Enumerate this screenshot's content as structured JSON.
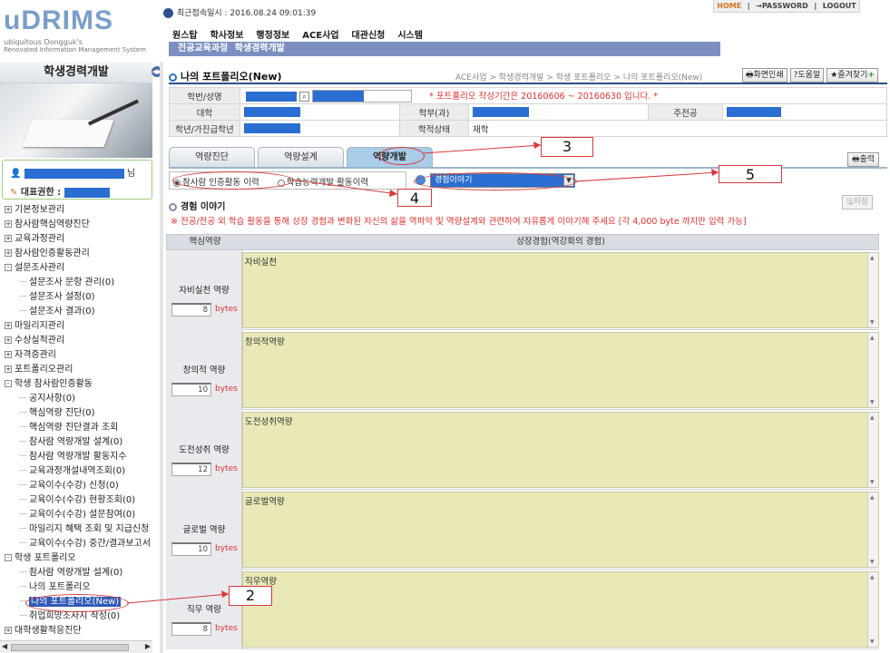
{
  "logo": {
    "title": "uDRIMS",
    "line1": "ubiquitous Dongguk's",
    "line2": "Renovated Information Management System"
  },
  "last_login": "최근접속일시 : 2016.08.24 09:01:39",
  "top_links": {
    "home": "HOME",
    "password": "PASSWORD",
    "logout": "LOGOUT",
    "sep": "|"
  },
  "main_menu": [
    "원스탑",
    "학사정보",
    "행정정보",
    "ACE사업",
    "대관신청",
    "시스템"
  ],
  "sub_menu": [
    "전공교육과정",
    "학생경력개발"
  ],
  "left": {
    "heading": "학생경력개발",
    "user_suffix": "님",
    "role_label": "대표권한 :"
  },
  "tree": [
    {
      "label": "기본정보관리",
      "level": 0,
      "sign": "+"
    },
    {
      "label": "참사람핵심역량진단",
      "level": 0,
      "sign": "+"
    },
    {
      "label": "교육과정관리",
      "level": 0,
      "sign": "+"
    },
    {
      "label": "참사람인증활동관리",
      "level": 0,
      "sign": "+"
    },
    {
      "label": "설문조사관리",
      "level": 0,
      "sign": "-"
    },
    {
      "label": "설문조사 문항 관리(0)",
      "level": 1
    },
    {
      "label": "설문조사 설정(0)",
      "level": 1
    },
    {
      "label": "설문조사 결과(0)",
      "level": 1
    },
    {
      "label": "마일리지관리",
      "level": 0,
      "sign": "+"
    },
    {
      "label": "수상실적관리",
      "level": 0,
      "sign": "+"
    },
    {
      "label": "자격증관리",
      "level": 0,
      "sign": "+"
    },
    {
      "label": "포트폴리오관리",
      "level": 0,
      "sign": "+"
    },
    {
      "label": "학생 참사람인증활동",
      "level": 0,
      "sign": "-"
    },
    {
      "label": "공지사항(0)",
      "level": 1
    },
    {
      "label": "핵심역량 진단(0)",
      "level": 1
    },
    {
      "label": "핵심역량 진단결과 조회",
      "level": 1
    },
    {
      "label": "참사람 역량개발 설계(0)",
      "level": 1
    },
    {
      "label": "참사람 역량개발 활동지수",
      "level": 1
    },
    {
      "label": "교육과정개설내역조회(0)",
      "level": 1
    },
    {
      "label": "교육이수(수강) 신청(0)",
      "level": 1
    },
    {
      "label": "교육이수(수강) 현황조회(0)",
      "level": 1
    },
    {
      "label": "교육이수(수강) 설문참여(0)",
      "level": 1
    },
    {
      "label": "마일리지 혜택 조회 및 지급신청",
      "level": 1
    },
    {
      "label": "교육이수(수강) 중간/결과보고서",
      "level": 1
    },
    {
      "label": "학생 포트폴리오",
      "level": 0,
      "sign": "-"
    },
    {
      "label": "참사람 역량개발 설계(0)",
      "level": 1
    },
    {
      "label": "나의 포트폴리오",
      "level": 1
    },
    {
      "label": "나의 포트폴리오(New)",
      "level": 1,
      "selected": true
    },
    {
      "label": "취업희망조사지 작성(0)",
      "level": 1
    },
    {
      "label": "대학생활적응진단",
      "level": 0,
      "sign": "+"
    }
  ],
  "content": {
    "title": "나의 포트폴리오(New)",
    "breadcrumb": "ACE사업 > 학생경력개발 > 학생 포트폴리오 > 나의 포트폴리오(New)",
    "buttons": {
      "print_screen": "화면인쇄",
      "help": "도움말",
      "favorite": "즐겨찾기"
    },
    "info": {
      "student_label": "학번/성명",
      "notice": "* 포트폴리오  작성기간은 20160606 ~ 20160630 입니다. *",
      "college_label": "대학",
      "dept_label": "학부(과)",
      "major_label": "주전공",
      "grade_label": "학년/가진급학년",
      "status_label": "학적상태",
      "status_value": "재학"
    },
    "tabs": [
      {
        "label": "역량진단",
        "active": false
      },
      {
        "label": "역량설계",
        "active": false
      },
      {
        "label": "역량개발",
        "active": true
      }
    ],
    "print_button": "출력",
    "radios": [
      {
        "label": "참사람 인증활동 이력",
        "checked": true
      },
      {
        "label": "학습능력개발 활동이력",
        "checked": false
      }
    ],
    "select_value": "경험이야기",
    "section_title": "경험 이야기",
    "save_button": "저장",
    "instruction": "※ 전공/전공 외 학습 활동을 통해 성장 경험과 변화된 자신의 삶을 역파악 및 역량설계와 관련하여 자유롭게 이야기해 주세요 [각 4,000 byte 까지만 입력 가능]",
    "grid_headers": [
      "핵심역량",
      "성장경험(역강화의 경험)"
    ],
    "rows": [
      {
        "name": "자비실천 역량",
        "bytes": "8",
        "text": "자비실천"
      },
      {
        "name": "창의적 역량",
        "bytes": "10",
        "text": "창의적역량"
      },
      {
        "name": "도전성취 역량",
        "bytes": "12",
        "text": "도전성취역량"
      },
      {
        "name": "글로벌 역량",
        "bytes": "10",
        "text": "글로벌역량"
      },
      {
        "name": "직무 역량",
        "bytes": "8",
        "text": "직무역량"
      }
    ],
    "bytes_unit": "bytes"
  },
  "annotations": [
    "2",
    "3",
    "4",
    "5"
  ],
  "colors": {
    "accent": "#2d4f88",
    "warn": "#e0302f",
    "mask": "#2a6ed1",
    "textarea": "#eae8b6",
    "annotation": "#d63a3a"
  }
}
